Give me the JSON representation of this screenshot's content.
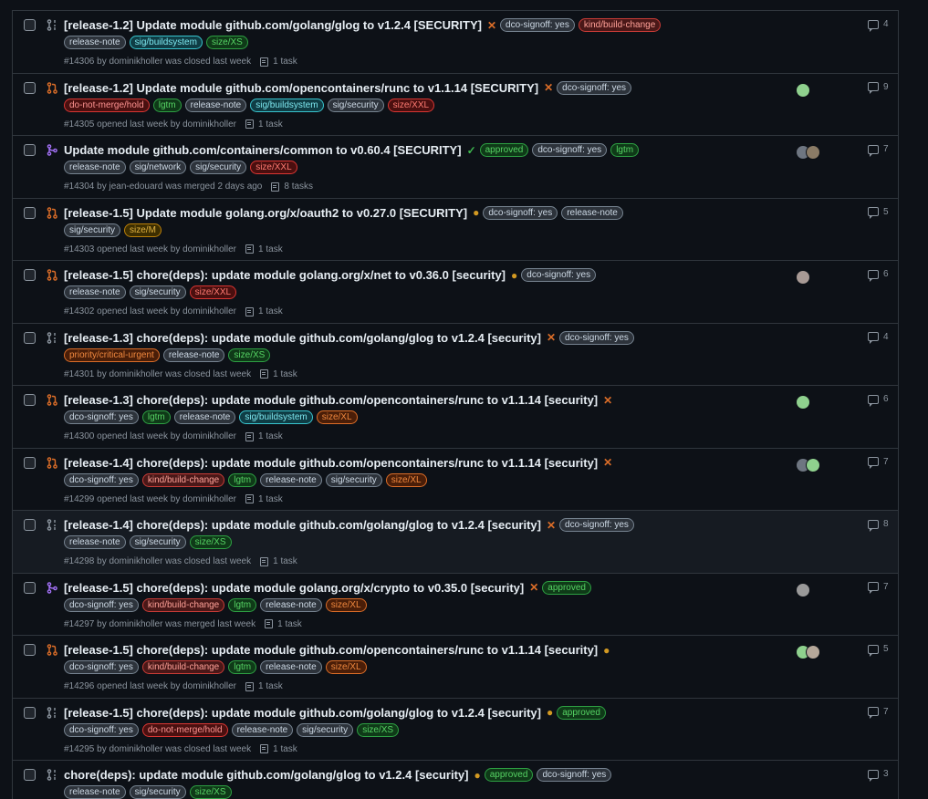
{
  "label_colors": {
    "release-note": {
      "bg": "#2d333b",
      "border": "#768390",
      "fg": "#cdd9e5"
    },
    "sig/buildsystem": {
      "bg": "#0f3d45",
      "border": "#39c5cf",
      "fg": "#7ee8f0"
    },
    "size/XS": {
      "bg": "#0f3a18",
      "border": "#2ea043",
      "fg": "#56d364"
    },
    "size/M": {
      "bg": "#3d2e00",
      "border": "#bb8009",
      "fg": "#e3b341"
    },
    "size/XL": {
      "bg": "#4a1e08",
      "border": "#db6d28",
      "fg": "#f0883e"
    },
    "size/XXL": {
      "bg": "#4a0f0f",
      "border": "#da3633",
      "fg": "#ff7b72"
    },
    "dco-signoff: yes": {
      "bg": "#2d333b",
      "border": "#768390",
      "fg": "#cdd9e5"
    },
    "kind/build-change": {
      "bg": "#4a1818",
      "border": "#c93c37",
      "fg": "#ffa198"
    },
    "do-not-merge/hold": {
      "bg": "#4a1010",
      "border": "#da3633",
      "fg": "#ff9492"
    },
    "lgtm": {
      "bg": "#0f3a18",
      "border": "#2ea043",
      "fg": "#56d364"
    },
    "approved": {
      "bg": "#0f3a18",
      "border": "#2ea043",
      "fg": "#56d364"
    },
    "sig/security": {
      "bg": "#2d333b",
      "border": "#768390",
      "fg": "#cdd9e5"
    },
    "sig/network": {
      "bg": "#2d333b",
      "border": "#768390",
      "fg": "#cdd9e5"
    },
    "priority/critical-urgent": {
      "bg": "#4a1e08",
      "border": "#db6d28",
      "fg": "#f0883e"
    }
  },
  "rows": [
    {
      "state": "closed",
      "title": "[release-1.2] Update module github.com/golang/glog to v1.2.4 [SECURITY]",
      "check": "fail",
      "title_labels": [
        "dco-signoff: yes",
        "kind/build-change"
      ],
      "labels": [
        "release-note",
        "sig/buildsystem",
        "size/XS"
      ],
      "meta": "#14306 by dominikholler was closed last week",
      "tasks": "1 task",
      "avatars": [],
      "comments": "4"
    },
    {
      "state": "open",
      "title": "[release-1.2] Update module github.com/opencontainers/runc to v1.1.14 [SECURITY]",
      "check": "fail",
      "title_labels": [
        "dco-signoff: yes"
      ],
      "labels": [
        "do-not-merge/hold",
        "lgtm",
        "release-note",
        "sig/buildsystem",
        "sig/security",
        "size/XXL"
      ],
      "meta": "#14305 opened last week by dominikholler",
      "tasks": "1 task",
      "avatars": [
        "#8fd18e"
      ],
      "comments": "9"
    },
    {
      "state": "merged",
      "title": "Update module github.com/containers/common to v0.60.4 [SECURITY]",
      "check": "ok",
      "title_labels": [
        "approved",
        "dco-signoff: yes",
        "lgtm"
      ],
      "labels": [
        "release-note",
        "sig/network",
        "sig/security",
        "size/XXL"
      ],
      "meta": "#14304 by jean-edouard was merged 2 days ago",
      "tasks": "8 tasks",
      "avatars": [
        "#6e7681",
        "#8a7b66"
      ],
      "comments": "7"
    },
    {
      "state": "open",
      "title": "[release-1.5] Update module golang.org/x/oauth2 to v0.27.0 [SECURITY]",
      "check": "pending",
      "title_labels": [
        "dco-signoff: yes",
        "release-note"
      ],
      "labels": [
        "sig/security",
        "size/M"
      ],
      "meta": "#14303 opened last week by dominikholler",
      "tasks": "1 task",
      "avatars": [],
      "comments": "5"
    },
    {
      "state": "open",
      "title": "[release-1.5] chore(deps): update module golang.org/x/net to v0.36.0 [security]",
      "check": "pending",
      "title_labels": [
        "dco-signoff: yes"
      ],
      "labels": [
        "release-note",
        "sig/security",
        "size/XXL"
      ],
      "meta": "#14302 opened last week by dominikholler",
      "tasks": "1 task",
      "avatars": [
        "#a89a95"
      ],
      "comments": "6"
    },
    {
      "state": "closed",
      "title": "[release-1.3] chore(deps): update module github.com/golang/glog to v1.2.4 [security]",
      "check": "fail",
      "title_labels": [
        "dco-signoff: yes"
      ],
      "labels": [
        "priority/critical-urgent",
        "release-note",
        "size/XS"
      ],
      "meta": "#14301 by dominikholler was closed last week",
      "tasks": "1 task",
      "avatars": [],
      "comments": "4"
    },
    {
      "state": "open",
      "title": "[release-1.3] chore(deps): update module github.com/opencontainers/runc to v1.1.14 [security]",
      "check": "fail",
      "title_labels": [],
      "labels": [
        "dco-signoff: yes",
        "lgtm",
        "release-note",
        "sig/buildsystem",
        "size/XL"
      ],
      "meta": "#14300 opened last week by dominikholler",
      "tasks": "1 task",
      "avatars": [
        "#8fd18e"
      ],
      "comments": "6"
    },
    {
      "state": "open",
      "title": "[release-1.4] chore(deps): update module github.com/opencontainers/runc to v1.1.14 [security]",
      "check": "fail",
      "title_labels": [],
      "labels": [
        "dco-signoff: yes",
        "kind/build-change",
        "lgtm",
        "release-note",
        "sig/security",
        "size/XL"
      ],
      "meta": "#14299 opened last week by dominikholler",
      "tasks": "1 task",
      "avatars": [
        "#6e7681",
        "#8fd18e"
      ],
      "comments": "7"
    },
    {
      "state": "closed",
      "title": "[release-1.4] chore(deps): update module github.com/golang/glog to v1.2.4 [security]",
      "check": "fail",
      "title_labels": [
        "dco-signoff: yes"
      ],
      "labels": [
        "release-note",
        "sig/security",
        "size/XS"
      ],
      "meta": "#14298 by dominikholler was closed last week",
      "tasks": "1 task",
      "avatars": [],
      "comments": "8",
      "hover": true
    },
    {
      "state": "merged",
      "title": "[release-1.5] chore(deps): update module golang.org/x/crypto to v0.35.0 [security]",
      "check": "fail",
      "title_labels": [
        "approved"
      ],
      "labels": [
        "dco-signoff: yes",
        "kind/build-change",
        "lgtm",
        "release-note",
        "size/XL"
      ],
      "meta": "#14297 by dominikholler was merged last week",
      "tasks": "1 task",
      "avatars": [
        "#9a9a9a"
      ],
      "comments": "7"
    },
    {
      "state": "open",
      "title": "[release-1.5] chore(deps): update module github.com/opencontainers/runc to v1.1.14 [security]",
      "check": "pending",
      "title_labels": [],
      "labels": [
        "dco-signoff: yes",
        "kind/build-change",
        "lgtm",
        "release-note",
        "size/XL"
      ],
      "meta": "#14296 opened last week by dominikholler",
      "tasks": "1 task",
      "avatars": [
        "#8fd18e",
        "#b5a89a"
      ],
      "comments": "5"
    },
    {
      "state": "closed",
      "title": "[release-1.5] chore(deps): update module github.com/golang/glog to v1.2.4 [security]",
      "check": "pending",
      "title_labels": [
        "approved"
      ],
      "labels": [
        "dco-signoff: yes",
        "do-not-merge/hold",
        "release-note",
        "sig/security",
        "size/XS"
      ],
      "meta": "#14295 by dominikholler was closed last week",
      "tasks": "1 task",
      "avatars": [],
      "comments": "7"
    },
    {
      "state": "closed",
      "title": "chore(deps): update module github.com/golang/glog to v1.2.4 [security]",
      "check": "pending",
      "title_labels": [
        "approved",
        "dco-signoff: yes"
      ],
      "labels": [
        "release-note",
        "sig/security",
        "size/XS"
      ],
      "meta": "",
      "tasks": "",
      "avatars": [],
      "comments": "3"
    }
  ],
  "state_colors": {
    "open": "#db6d28",
    "closed": "#8b949e",
    "merged": "#a371f7"
  },
  "check_glyphs": {
    "fail": "✕",
    "ok": "✓",
    "pending": "●"
  }
}
